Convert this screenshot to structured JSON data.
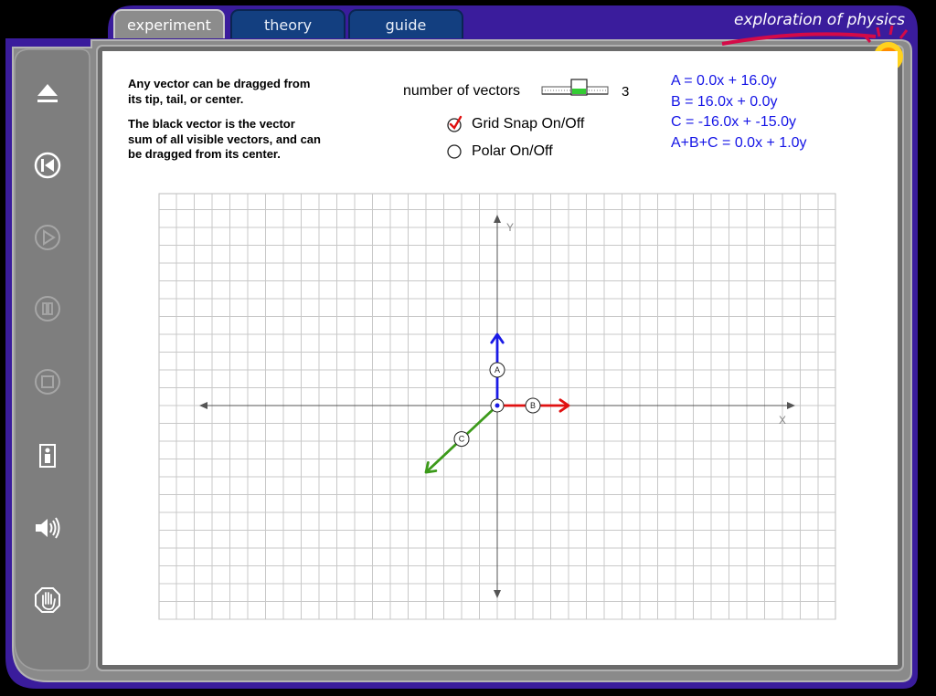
{
  "tabs": [
    {
      "label": "experiment",
      "active": true
    },
    {
      "label": "theory",
      "active": false
    },
    {
      "label": "guide",
      "active": false
    }
  ],
  "brand": "exploration of physics",
  "instructions": {
    "line1": "Any vector can be dragged from",
    "line2": "its tip, tail, or center.",
    "line3": "The black vector is the vector",
    "line4": "sum of all visible vectors, and can",
    "line5": "be dragged from its center."
  },
  "controls": {
    "vectors_label": "number of vectors",
    "vectors_count": "3",
    "vectors_value": 3,
    "grid_snap_label": "Grid Snap On/Off",
    "grid_snap_checked": true,
    "polar_label": "Polar On/Off",
    "polar_checked": false
  },
  "equations": {
    "a": "A = 0.0x + 16.0y",
    "b": "B = 16.0x + 0.0y",
    "c": "C = -16.0x + -15.0y",
    "sum": "A+B+C = 0.0x + 1.0y"
  },
  "axes": {
    "x_label": "X",
    "y_label": "Y"
  },
  "vectors": [
    {
      "id": "A",
      "x": 0,
      "y": 16,
      "color": "#1a1ae6"
    },
    {
      "id": "B",
      "x": 16,
      "y": 0,
      "color": "#e01010"
    },
    {
      "id": "C",
      "x": -16,
      "y": -15,
      "color": "#3c9a1a"
    }
  ],
  "sidebar": {
    "items": [
      {
        "icon": "eject-icon",
        "enabled": true
      },
      {
        "icon": "rewind-icon",
        "enabled": true
      },
      {
        "icon": "play-icon",
        "enabled": false
      },
      {
        "icon": "pause-icon",
        "enabled": false
      },
      {
        "icon": "stop-icon",
        "enabled": false
      },
      {
        "icon": "info-icon",
        "enabled": true
      },
      {
        "icon": "sound-icon",
        "enabled": true
      },
      {
        "icon": "hand-icon",
        "enabled": true
      }
    ]
  },
  "colors": {
    "frame_purple": "#3a1c9c",
    "panel_gray": "#8a8a8a",
    "tab_blue": "#133f80",
    "equation_blue": "#1414e6"
  }
}
